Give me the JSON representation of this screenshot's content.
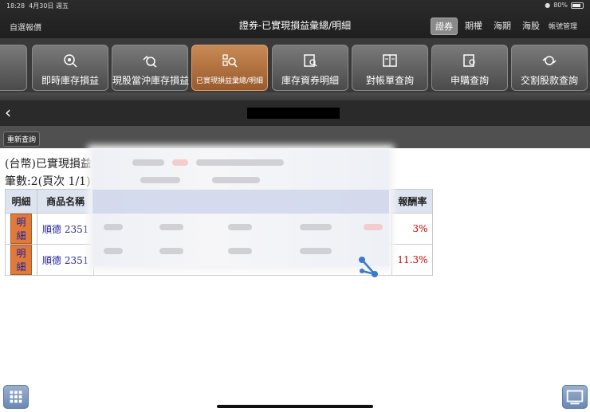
{
  "status_bar": {
    "time": "18:28",
    "date": "4月30日 週五",
    "battery": "80%"
  },
  "header": {
    "left_link": "自選報價",
    "title": "證券-已實現損益彙總/明細",
    "market_tabs": [
      "證券",
      "期權",
      "海期",
      "海股"
    ],
    "active_market_tab": "證券",
    "account_mgmt": "帳號管理"
  },
  "menu": {
    "items": [
      {
        "label": "報",
        "icon": "report-icon"
      },
      {
        "label": "即時庫存損益",
        "icon": "inventory-search-icon"
      },
      {
        "label": "現股當沖庫存損益",
        "icon": "daytrade-search-icon"
      },
      {
        "label": "已實現損益彙總/明細",
        "icon": "realized-pl-icon",
        "active": true
      },
      {
        "label": "庫存資券明細",
        "icon": "margin-detail-icon"
      },
      {
        "label": "對帳單查詢",
        "icon": "statement-icon"
      },
      {
        "label": "申購查詢",
        "icon": "subscription-search-icon"
      },
      {
        "label": "交割股款查詢",
        "icon": "settlement-icon"
      }
    ]
  },
  "toolbar": {
    "requery_label": "重新查詢"
  },
  "results": {
    "heading": "(台幣)已實現損益",
    "count_text": "筆數:2(頁次 1/1)",
    "columns": [
      "明細",
      "商品名稱",
      "",
      "報酬率"
    ],
    "rows": [
      {
        "detail": "明細",
        "name": "順德 2351",
        "rate": "3%"
      },
      {
        "detail": "明細",
        "name": "順德 2351",
        "rate": "11.3%"
      }
    ]
  },
  "colors": {
    "accent_orange": "#e07a3a",
    "header_bg": "#dde3ef",
    "positive_red": "#c00000",
    "link_blue": "#2020a0"
  }
}
